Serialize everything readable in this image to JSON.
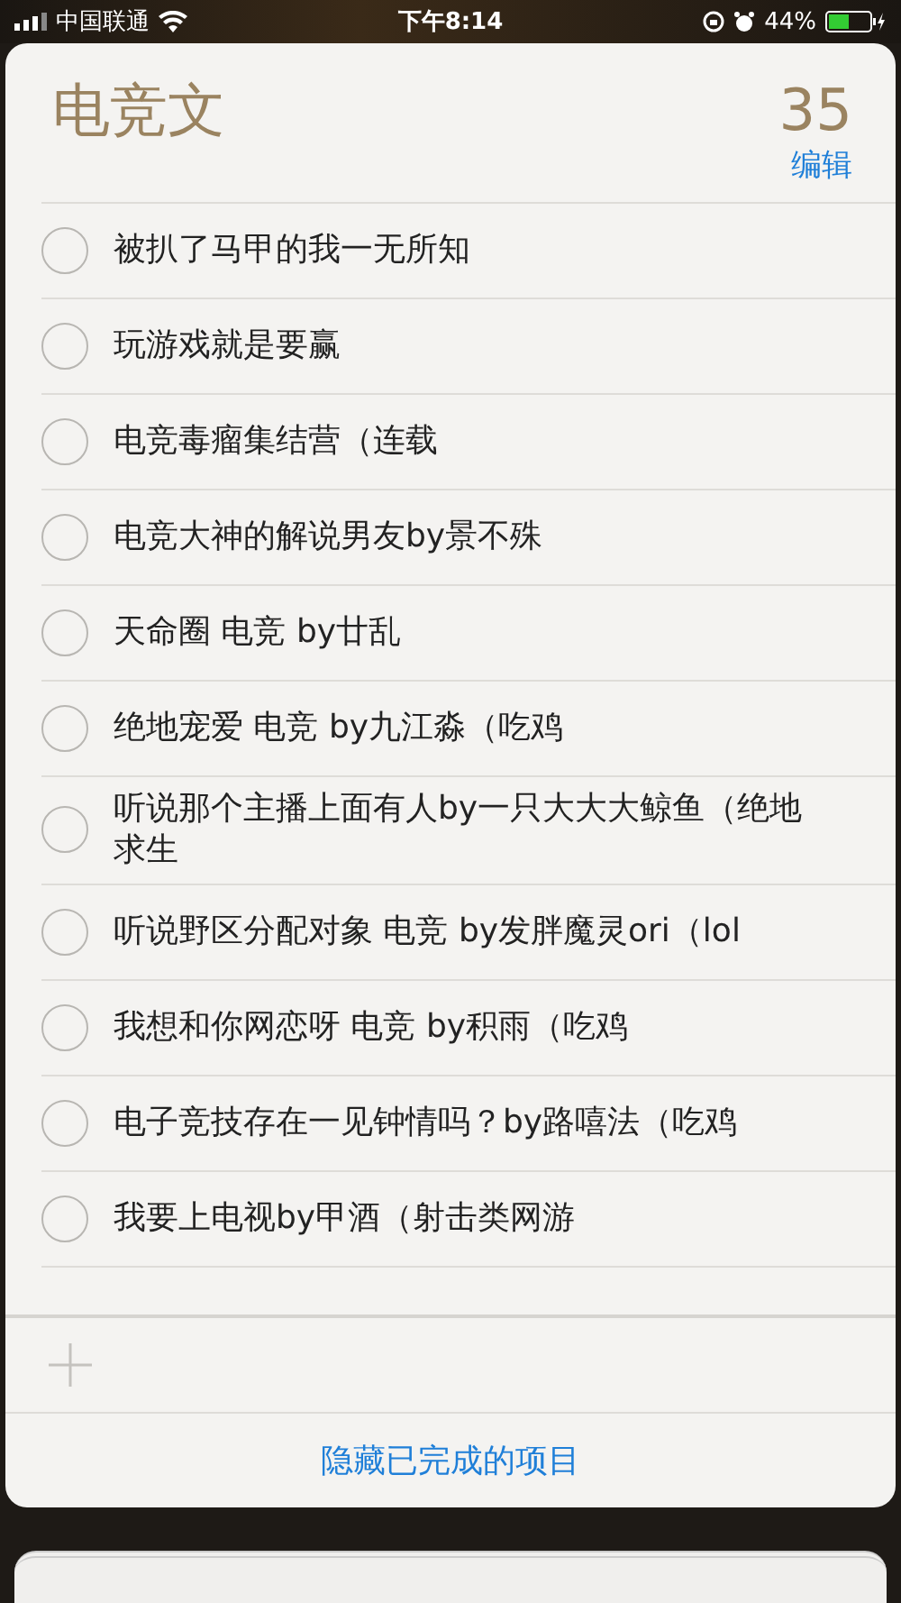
{
  "status_bar": {
    "carrier": "中国联通",
    "time": "下午8:14",
    "battery": "44%"
  },
  "list": {
    "title": "电竞文",
    "count": "35",
    "edit": "编辑"
  },
  "items": [
    {
      "text": "被扒了马甲的我一无所知",
      "checked": false
    },
    {
      "text": "玩游戏就是要赢",
      "checked": false
    },
    {
      "text": "电竞毒瘤集结营（连载",
      "checked": false
    },
    {
      "text": "电竞大神的解说男友by景不殊",
      "checked": false
    },
    {
      "text": "天命圈 电竞 by廿乱",
      "checked": false
    },
    {
      "text": "绝地宠爱 电竞 by九江淼（吃鸡",
      "checked": false
    },
    {
      "text": "听说那个主播上面有人by一只大大大鲸鱼（绝地求生",
      "checked": false
    },
    {
      "text": "听说野区分配对象 电竞 by发胖魔灵ori（lol",
      "checked": false
    },
    {
      "text": "我想和你网恋呀 电竞 by积雨（吃鸡",
      "checked": false
    },
    {
      "text": "电子竞技存在一见钟情吗？by路嘻法（吃鸡",
      "checked": false
    },
    {
      "text": "我要上电视by甲酒（射击类网游",
      "checked": false
    }
  ],
  "footer": {
    "hide_completed": "隐藏已完成的项目"
  }
}
